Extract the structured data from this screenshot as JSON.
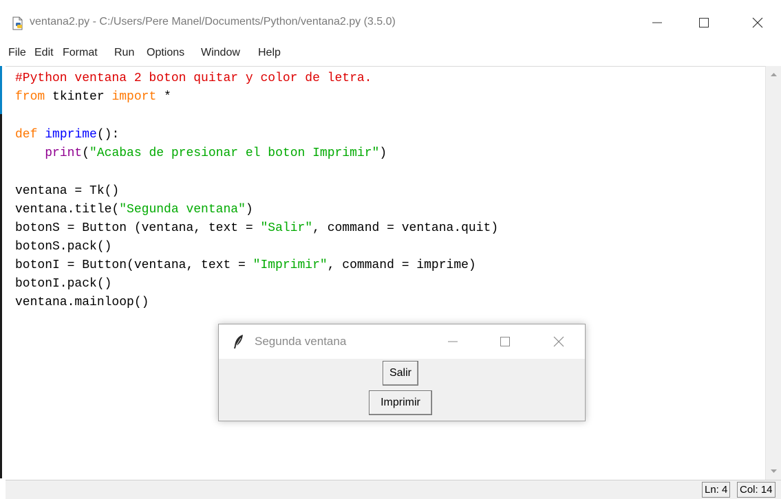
{
  "window": {
    "title": "ventana2.py - C:/Users/Pere Manel/Documents/Python/ventana2.py (3.5.0)"
  },
  "menu": {
    "items": [
      {
        "label": "File"
      },
      {
        "label": "Edit"
      },
      {
        "label": "Format"
      },
      {
        "label": "Run"
      },
      {
        "label": "Options"
      },
      {
        "label": "Window"
      },
      {
        "label": "Help"
      }
    ]
  },
  "code": {
    "l1": {
      "comment": "#Python ventana 2 boton quitar y color de letra."
    },
    "l2": {
      "kw1": "from",
      "mid": " tkinter ",
      "kw2": "import",
      "rest": " *"
    },
    "l4": {
      "kw": "def",
      "space": " ",
      "name": "imprime",
      "rest": "():"
    },
    "l5": {
      "indent": "    ",
      "builtin": "print",
      "open": "(",
      "str": "\"Acabas de presionar el boton Imprimir\"",
      "close": ")"
    },
    "l7": "ventana = Tk()",
    "l8": {
      "pre": "ventana.title(",
      "str": "\"Segunda ventana\"",
      "post": ")"
    },
    "l9": {
      "pre": "botonS = Button (ventana, text = ",
      "str": "\"Salir\"",
      "post": ", command = ventana.quit)"
    },
    "l10": "botonS.pack()",
    "l11": {
      "pre": "botonI = Button(ventana, text = ",
      "str": "\"Imprimir\"",
      "post": ", command = imprime)"
    },
    "l12": "botonI.pack()",
    "l13": "ventana.mainloop()"
  },
  "status": {
    "line": "Ln: 4",
    "col": "Col: 14"
  },
  "tk_window": {
    "title": "Segunda ventana",
    "salir_label": "Salir",
    "imprimir_label": "Imprimir"
  },
  "icons": {
    "app": "python-file-icon",
    "tk": "tk-feather-icon"
  }
}
